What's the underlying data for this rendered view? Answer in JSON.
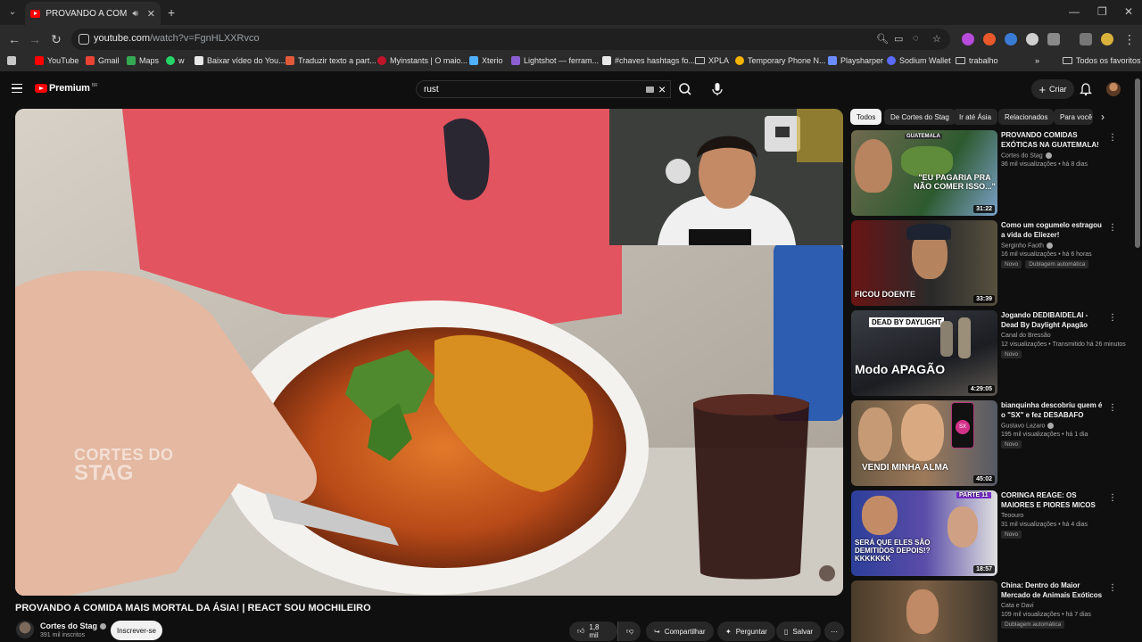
{
  "browser": {
    "tab_title": "PROVANDO A COMIDA MAIS MORTAL DA ÁSIA! | REACT SOU MOCHILEIRO",
    "url_host": "youtube.com",
    "url_path": "/watch?v=FgnHLXXRvco",
    "bookmarks": [
      {
        "label": "YouTube"
      },
      {
        "label": "Gmail"
      },
      {
        "label": "Maps"
      },
      {
        "label": "w"
      },
      {
        "label": "Baixar vídeo do You..."
      },
      {
        "label": "Traduzir texto a part..."
      },
      {
        "label": "Myinstants | O maio..."
      },
      {
        "label": "Xterio"
      },
      {
        "label": "Lightshot — ferram..."
      },
      {
        "label": "#chaves hashtags fo..."
      },
      {
        "label": "XPLA"
      },
      {
        "label": "Temporary Phone N..."
      },
      {
        "label": "Playsharper"
      },
      {
        "label": "Sodium Wallet"
      },
      {
        "label": "trabalho"
      }
    ],
    "bookmarks_overflow": "»",
    "all_bookmarks": "Todos os favoritos"
  },
  "masthead": {
    "logo": "Premium",
    "logo_sup": "BR",
    "search_query": "rust",
    "create_label": "Criar"
  },
  "player": {
    "watermark_line1": "CORTES DO",
    "watermark_line2": "STAG"
  },
  "video": {
    "title": "PROVANDO A COMIDA MAIS MORTAL DA ÁSIA! | REACT SOU MOCHILEIRO",
    "channel": "Cortes do Stag",
    "subscribers": "391 mil inscritos",
    "subscribe_label": "Inscrever-se",
    "likes": "1,8 mil",
    "share_label": "Compartilhar",
    "ask_label": "Perguntar",
    "save_label": "Salvar"
  },
  "chips": [
    "Todos",
    "De Cortes do Stag",
    "Ir até Ásia",
    "Relacionados",
    "Para você"
  ],
  "recommendations": [
    {
      "title": "PROVANDO COMIDAS EXÓTICAS NA GUATEMALA! VOCÊ TERIA ...",
      "channel": "Cortes do Stag",
      "meta": "36 mil visualizações • há 8 dias",
      "duration": "31:22",
      "thumb_text": "\"EU PAGARIA PRA NÃO COMER ISSO...\"",
      "thumb_tag": "GUATEMALA",
      "badges": []
    },
    {
      "title": "Como um cogumelo estragou a vida do Eliezer!",
      "channel": "Serginho Faoth",
      "meta": "16 mil visualizações • há 6 horas",
      "duration": "33:39",
      "thumb_text": "FICOU DOENTE",
      "thumb_tag": "",
      "badges": [
        "Novo",
        "Dublagem automática"
      ]
    },
    {
      "title": "Jogando DEDIBAIDELAI - Dead By Daylight Apagão (Lights out mode)",
      "channel": "Canal do Bressão",
      "meta": "12 visualizações • Transmitido há 26 minutos",
      "duration": "4:29:05",
      "thumb_text": "Modo APAGÃO",
      "thumb_tag": "DEAD BY DAYLIGHT",
      "badges": [
        "Novo"
      ]
    },
    {
      "title": "bianquinha descobriu quem é o \"SX\" e fez DESABAFO",
      "channel": "Gustavo Lazaro",
      "meta": "195 mil visualizações • há 1 dia",
      "duration": "45:02",
      "thumb_text": "VENDI MINHA ALMA",
      "thumb_tag": "SX",
      "badges": [
        "Novo"
      ]
    },
    {
      "title": "CORINGA REAGE: OS MAIORES E PIORES MICOS DA TV!",
      "channel": "Teoouro",
      "meta": "31 mil visualizações • há 4 dias",
      "duration": "18:57",
      "thumb_text": "SERÁ QUE ELES SÃO DEMITIDOS DEPOIS!? KKKKKKK",
      "thumb_tag": "PARTE 11",
      "badges": [
        "Novo"
      ]
    },
    {
      "title": "China: Dentro do Maior Mercado de Animais Exóticos do Mundo!",
      "channel": "Cata e Davi",
      "meta": "109 mil visualizações • há 7 dias",
      "duration": "",
      "thumb_text": "",
      "thumb_tag": "",
      "badges": [
        "Dublagem automática"
      ]
    }
  ]
}
